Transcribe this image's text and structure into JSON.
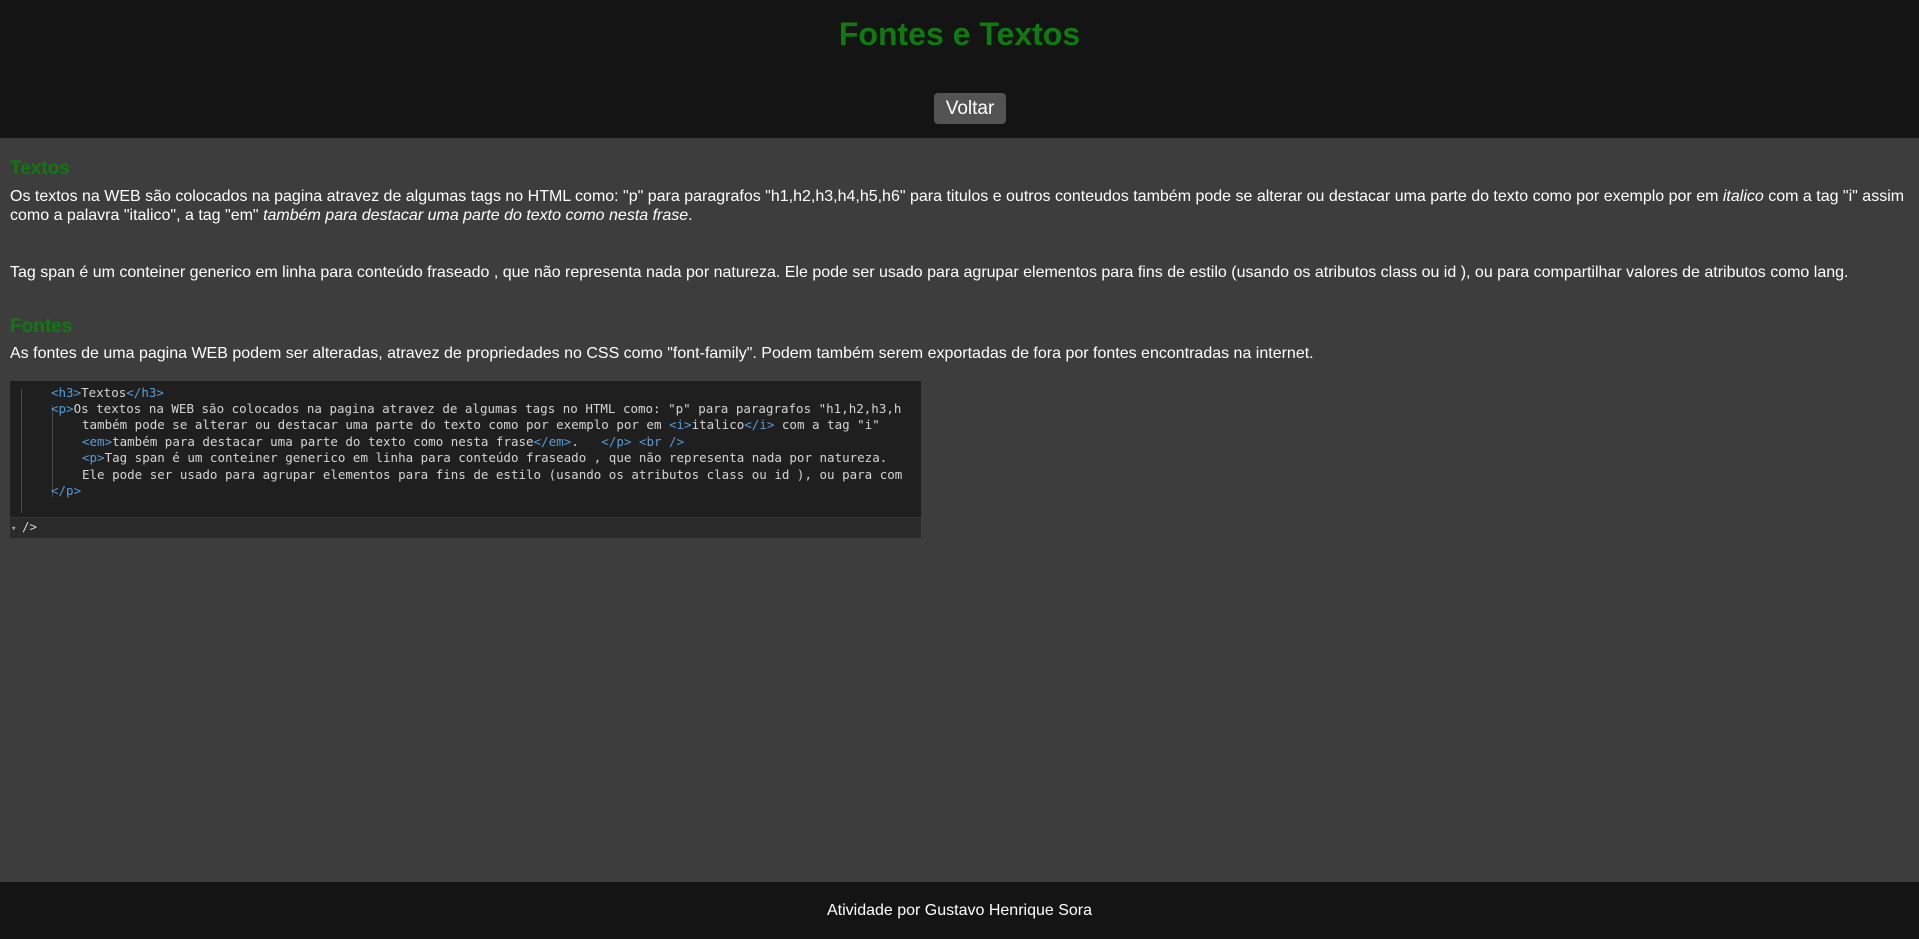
{
  "header": {
    "title": "Fontes e Textos",
    "back_label": "Voltar"
  },
  "textos": {
    "heading": "Textos",
    "p1_a": "Os textos na WEB são colocados na pagina atravez de algumas tags no HTML como: \"p\" para paragrafos \"h1,h2,h3,h4,h5,h6\" para titulos e outros conteudos também pode se alterar ou destacar uma parte do texto como por exemplo por em ",
    "p1_italic": "italico",
    "p1_b": " com a tag \"i\" assim como a palavra \"italico\", a tag \"em\" ",
    "p1_em": "também para destacar uma parte do texto como nesta frase",
    "p1_c": ".",
    "p2": "Tag span é um conteiner generico em linha para conteúdo fraseado , que não representa nada por natureza. Ele pode ser usado para agrupar elementos para fins de estilo (usando os atributos class ou id ), ou para compartilhar valores de atributos como lang."
  },
  "fontes": {
    "heading": "Fontes",
    "p": "As fontes de uma pagina WEB podem ser alteradas, atravez de propriedades no CSS como \"font-family\". Podem também serem exportadas de fora por fontes encontradas na internet."
  },
  "code": {
    "l1_open": "<h3>",
    "l1_text": "Textos",
    "l1_close": "</h3>",
    "l2_open": "<p>",
    "l2_text": "Os textos na WEB são colocados na pagina atravez de algumas tags no HTML como: \"p\" para paragrafos \"h1,h2,h3,h",
    "l3_a": "também pode se alterar ou destacar uma parte do texto como por exemplo por em ",
    "l3_i_open": "<i>",
    "l3_i_text": "italico",
    "l3_i_close": "</i>",
    "l3_b": " com a tag \"i\"",
    "l4_em_open": "<em>",
    "l4_em_text": "também para destacar uma parte do texto como nesta frase",
    "l4_em_close": "</em>",
    "l4_dot": ".   ",
    "l4_p_close": "</p>",
    "l4_sp": " ",
    "l4_br": "<br />",
    "l5_p_open": "<p>",
    "l5_text": "Tag span é um conteiner generico em linha para conteúdo fraseado , que não representa nada por natureza.",
    "l6_text": "Ele pode ser usado para agrupar elementos para fins de estilo (usando os atributos class ou id ), ou para com",
    "l7_close": "</p>",
    "l8_text": "/>"
  },
  "footer": {
    "text": "Atividade por Gustavo Henrique Sora"
  }
}
